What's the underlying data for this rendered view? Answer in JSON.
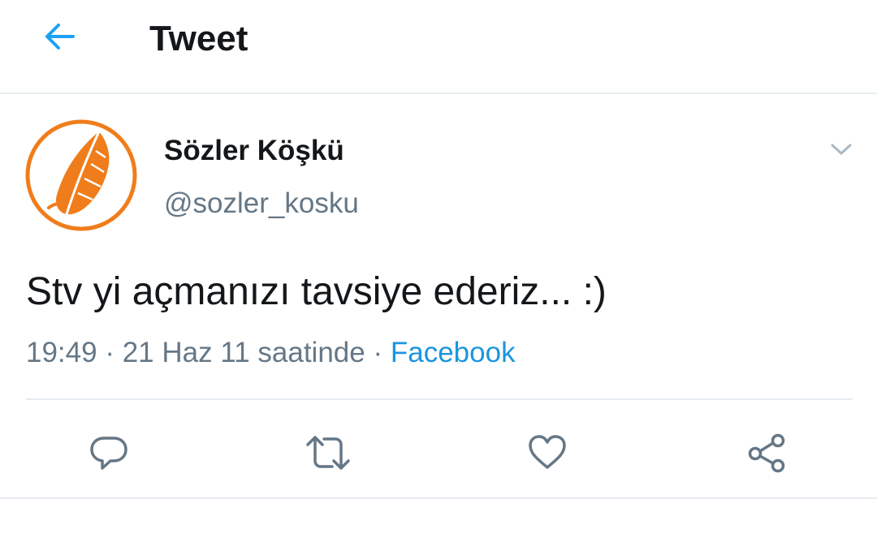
{
  "header": {
    "title": "Tweet",
    "back_icon": "arrow-left-icon",
    "accent_color": "#1da1f2"
  },
  "tweet": {
    "author": {
      "display_name": "Sözler Köşkü",
      "handle": "@sozler_kosku",
      "avatar_icon": "orange-feather-logo",
      "avatar_color": "#f07d1b"
    },
    "text": "Stv yi açmanızı tavsiye ederiz... :)",
    "time": "19:49",
    "date": "21 Haz 11",
    "date_suffix": "saatinde",
    "separator": "·",
    "source": "Facebook",
    "menu_icon": "chevron-down-icon"
  },
  "actions": [
    {
      "icon": "reply-icon"
    },
    {
      "icon": "retweet-icon"
    },
    {
      "icon": "heart-icon"
    },
    {
      "icon": "share-icon"
    }
  ],
  "colors": {
    "text_primary": "#14171a",
    "text_secondary": "#657786",
    "link": "#1b95e0",
    "border": "#e6ecf0"
  }
}
